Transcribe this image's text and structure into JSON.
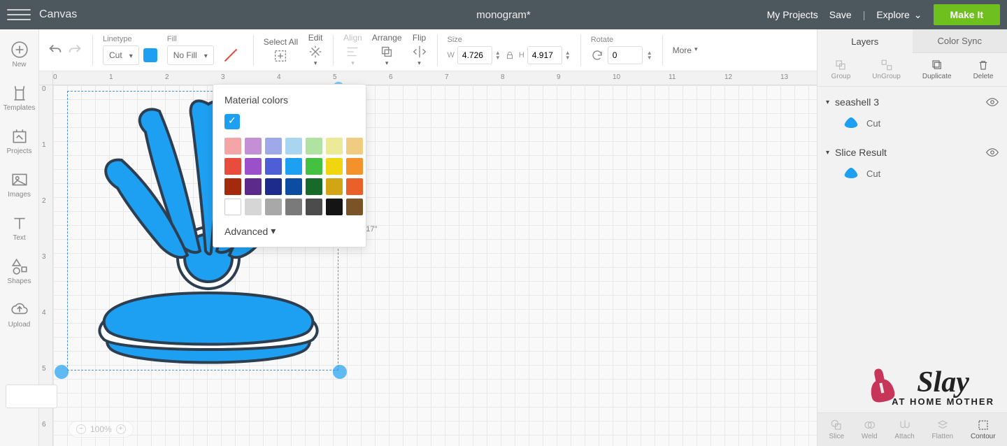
{
  "topbar": {
    "app_title": "Canvas",
    "doc_title": "monogram*",
    "my_projects": "My Projects",
    "save": "Save",
    "explore": "Explore",
    "make_it": "Make It"
  },
  "leftbar": {
    "new": "New",
    "templates": "Templates",
    "projects": "Projects",
    "images": "Images",
    "text": "Text",
    "shapes": "Shapes",
    "upload": "Upload"
  },
  "toolbar": {
    "linetype_label": "Linetype",
    "linetype_value": "Cut",
    "fill_label": "Fill",
    "fill_value": "No Fill",
    "select_all": "Select All",
    "edit": "Edit",
    "align": "Align",
    "arrange": "Arrange",
    "flip": "Flip",
    "size": "Size",
    "w_label": "W",
    "w_value": "4.726",
    "h_label": "H",
    "h_value": "4.917",
    "rotate": "Rotate",
    "rotate_value": "0",
    "more": "More",
    "swatch_color": "#1ea0f2"
  },
  "color_popup": {
    "title": "Material colors",
    "current_color": "#1ea0f2",
    "advanced": "Advanced",
    "swatches": [
      "#f4a6a6",
      "#c58fd6",
      "#9fa8e8",
      "#a8d6f0",
      "#b0e3a2",
      "#ecea98",
      "#f0cc81",
      "#e74c3c",
      "#9b4fc9",
      "#4e5fd6",
      "#1ea0f2",
      "#43c141",
      "#f1d50f",
      "#f3922a",
      "#a32a0c",
      "#5c2a8a",
      "#1d2c8c",
      "#0c4da2",
      "#186a2b",
      "#d1a514",
      "#e9602a",
      "#ffffff",
      "#d6d6d6",
      "#a8a8a8",
      "#7a7a7a",
      "#4c4c4c",
      "#141414",
      "#7a5426"
    ]
  },
  "canvas": {
    "dim_label": "4.917\"",
    "zoom": "100%",
    "ruler_h": [
      "0",
      "1",
      "2",
      "3",
      "4",
      "5",
      "6",
      "7",
      "8",
      "9",
      "10",
      "11",
      "12",
      "13"
    ],
    "ruler_v": [
      "0",
      "1",
      "2",
      "3",
      "4",
      "5",
      "6"
    ]
  },
  "rightbar": {
    "tab_layers": "Layers",
    "tab_colorsync": "Color Sync",
    "group": "Group",
    "ungroup": "UnGroup",
    "duplicate": "Duplicate",
    "delete": "Delete",
    "slice": "Slice",
    "weld": "Weld",
    "attach": "Attach",
    "flatten": "Flatten",
    "contour": "Contour",
    "layers": [
      {
        "name": "seashell 3",
        "child_label": "Cut"
      },
      {
        "name": "Slice Result",
        "child_label": "Cut"
      }
    ]
  },
  "watermark": {
    "brand": "Slay",
    "sub": "AT HOME MOTHER"
  }
}
